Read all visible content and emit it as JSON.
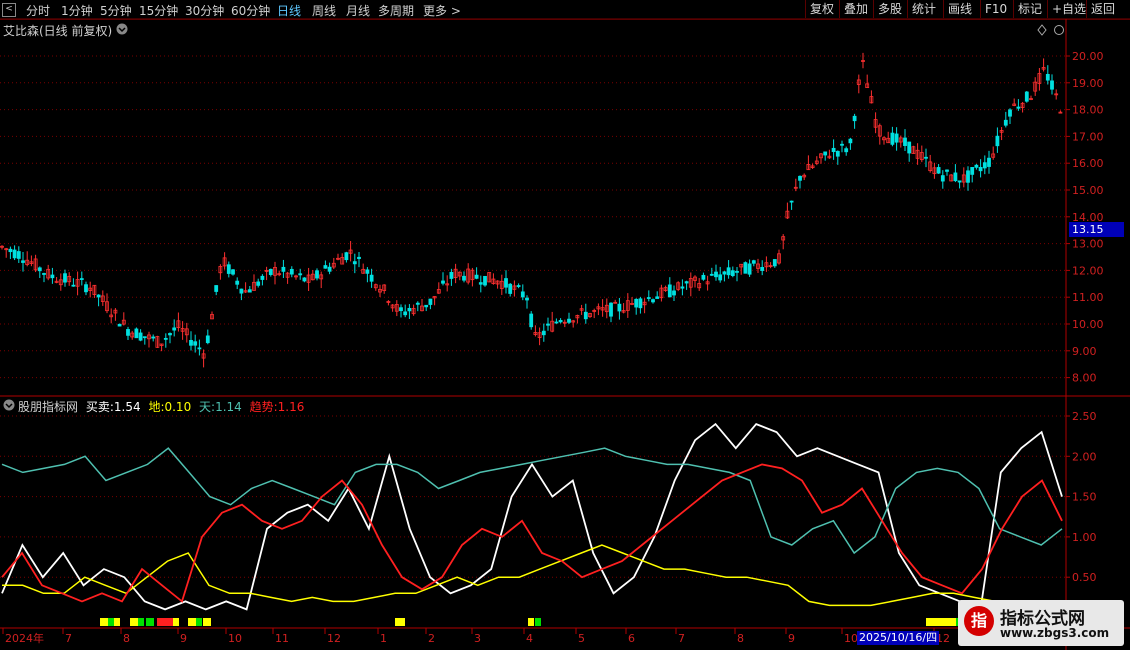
{
  "toolbar": {
    "back": "<",
    "periods": [
      "分时",
      "1分钟",
      "5分钟",
      "15分钟",
      "30分钟",
      "60分钟",
      "日线",
      "周线",
      "月线",
      "多周期",
      "更多 >"
    ],
    "active_period": "日线",
    "right_buttons": [
      "复权",
      "叠加",
      "多股",
      "统计",
      "画线",
      "F10",
      "标记",
      "+自选",
      "返回"
    ]
  },
  "main_chart": {
    "title": "艾比森(日线 前复权)",
    "price_axis": [
      "20.00",
      "19.00",
      "18.00",
      "17.00",
      "16.00",
      "15.00",
      "14.00",
      "13.00",
      "12.00",
      "11.00",
      "10.00",
      "9.00",
      "8.00"
    ],
    "current_price": "13.15"
  },
  "indicator": {
    "name": "股朋指标网",
    "values": [
      {
        "label": "买卖:",
        "value": "1.54",
        "color": "#ffffff"
      },
      {
        "label": "地:",
        "value": "0.10",
        "color": "#ffff00"
      },
      {
        "label": "天:",
        "value": "1.14",
        "color": "#4fc0b0"
      },
      {
        "label": "趋势:",
        "value": "1.16",
        "color": "#ff2020"
      }
    ],
    "axis": [
      "2.50",
      "2.00",
      "1.50",
      "1.00",
      "0.50"
    ]
  },
  "time_axis": {
    "labels": [
      "2024年",
      "7",
      "8",
      "9",
      "10",
      "11",
      "12",
      "1",
      "2",
      "3",
      "4",
      "5",
      "6",
      "7",
      "8",
      "9",
      "10",
      "12"
    ],
    "cursor_date": "2025/10/16/四"
  },
  "watermark": {
    "logo": "指",
    "title": "指标公式网",
    "url": "www.zbgs3.com"
  },
  "colors": {
    "up": "#ff3030",
    "down": "#00e0e0",
    "grid": "#7a0000",
    "white_line": "#ffffff",
    "yellow_line": "#ffff00",
    "teal_line": "#4fc0b0",
    "red_line": "#ff2020"
  },
  "chart_data": {
    "type": "line",
    "series": [
      {
        "name": "买卖",
        "values": [
          0.3,
          0.9,
          0.5,
          0.8,
          0.4,
          0.6,
          0.5,
          0.2,
          0.1,
          0.2,
          0.1,
          0.2,
          0.1,
          1.1,
          1.3,
          1.4,
          1.2,
          1.6,
          1.1,
          2.0,
          1.1,
          0.5,
          0.3,
          0.4,
          0.6,
          1.5,
          1.9,
          1.5,
          1.7,
          0.8,
          0.3,
          0.5,
          1.0,
          1.7,
          2.2,
          2.4,
          2.1,
          2.4,
          2.3,
          2.0,
          2.1,
          2.0,
          1.9,
          1.8,
          0.8,
          0.4,
          0.3,
          0.2,
          0.1,
          1.8,
          2.1,
          2.3,
          1.5
        ]
      },
      {
        "name": "地",
        "values": [
          0.4,
          0.4,
          0.3,
          0.3,
          0.5,
          0.4,
          0.3,
          0.5,
          0.7,
          0.8,
          0.4,
          0.3,
          0.3,
          0.25,
          0.2,
          0.25,
          0.2,
          0.2,
          0.25,
          0.3,
          0.3,
          0.4,
          0.5,
          0.4,
          0.5,
          0.5,
          0.6,
          0.7,
          0.8,
          0.9,
          0.8,
          0.7,
          0.6,
          0.6,
          0.55,
          0.5,
          0.5,
          0.45,
          0.4,
          0.2,
          0.15,
          0.15,
          0.15,
          0.2,
          0.25,
          0.3,
          0.3,
          0.25,
          0.2
        ]
      },
      {
        "name": "天",
        "values": [
          1.9,
          1.8,
          1.85,
          1.9,
          2.0,
          1.7,
          1.8,
          1.9,
          2.1,
          1.8,
          1.5,
          1.4,
          1.6,
          1.7,
          1.6,
          1.5,
          1.4,
          1.8,
          1.9,
          1.9,
          1.8,
          1.6,
          1.7,
          1.8,
          1.85,
          1.9,
          1.95,
          2.0,
          2.05,
          2.1,
          2.0,
          1.95,
          1.9,
          1.9,
          1.85,
          1.8,
          1.7,
          1.0,
          0.9,
          1.1,
          1.2,
          0.8,
          1.0,
          1.6,
          1.8,
          1.85,
          1.8,
          1.6,
          1.1,
          1.0,
          0.9,
          1.1
        ]
      },
      {
        "name": "趋势",
        "values": [
          0.5,
          0.8,
          0.4,
          0.3,
          0.2,
          0.3,
          0.2,
          0.6,
          0.4,
          0.2,
          1.0,
          1.3,
          1.4,
          1.2,
          1.1,
          1.2,
          1.5,
          1.7,
          1.4,
          0.9,
          0.5,
          0.35,
          0.5,
          0.9,
          1.1,
          1.0,
          1.2,
          0.8,
          0.7,
          0.5,
          0.6,
          0.7,
          0.9,
          1.1,
          1.3,
          1.5,
          1.7,
          1.8,
          1.9,
          1.85,
          1.7,
          1.3,
          1.4,
          1.6,
          1.2,
          0.8,
          0.5,
          0.4,
          0.3,
          0.6,
          1.1,
          1.5,
          1.7,
          1.2
        ]
      }
    ],
    "ylim": [
      0,
      2.6
    ]
  }
}
